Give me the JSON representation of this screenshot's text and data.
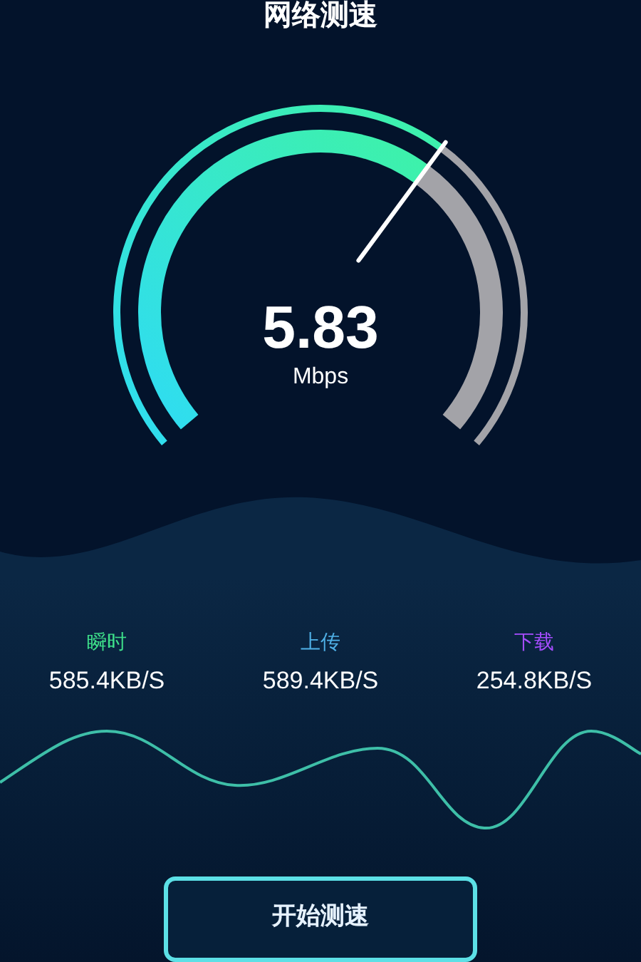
{
  "title": "网络测速",
  "gauge": {
    "value": "5.83",
    "unit": "Mbps"
  },
  "stats": [
    {
      "label": "瞬时",
      "value": "585.4KB/S",
      "color": "#3ee08a"
    },
    {
      "label": "上传",
      "value": "589.4KB/S",
      "color": "#4fb0e6"
    },
    {
      "label": "下载",
      "value": "254.8KB/S",
      "color": "#a64dff"
    }
  ],
  "start_button": {
    "label": "开始测速"
  }
}
